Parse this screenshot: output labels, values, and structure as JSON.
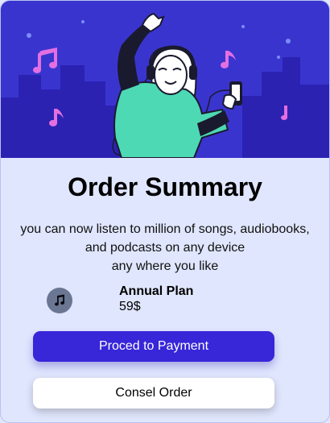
{
  "order": {
    "title": "Order Summary",
    "description_lines": [
      "you can now listen to million of songs, audiobooks,",
      "and podcasts on any device",
      "any where you like"
    ],
    "plan": {
      "icon": "music-note-icon",
      "name": "Annual Plan",
      "price": "59$"
    },
    "primary_button": "Proced to Payment",
    "secondary_button": "Consel Order"
  },
  "hero": {
    "illustration": "dancing woman with headphones and phone, music notes, city skyline"
  },
  "colors": {
    "page_background": "#e0e6fd",
    "hero_background": "#3a34cf",
    "accent": "#3826d9",
    "cancel_background": "#ffffff",
    "plan_icon_background": "#6b7693",
    "music_note": "#e36fe0"
  }
}
